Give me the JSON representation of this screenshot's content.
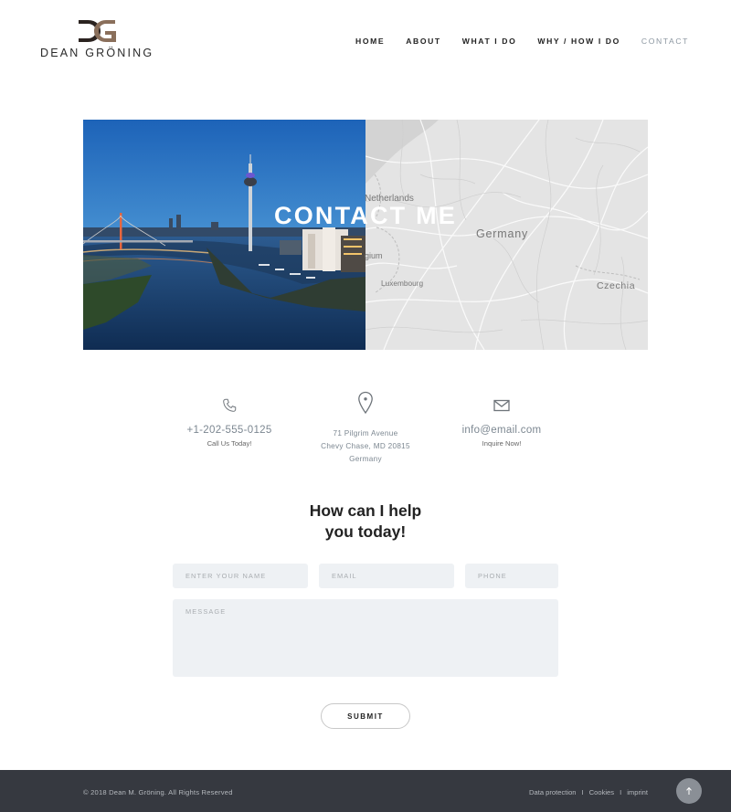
{
  "brand": {
    "name": "DEAN GRÖNING",
    "monogram": "DG"
  },
  "nav": {
    "items": [
      {
        "label": "HOME",
        "active": false
      },
      {
        "label": "ABOUT",
        "active": false
      },
      {
        "label": "WHAT I DO",
        "active": false
      },
      {
        "label": "WHY / HOW I DO",
        "active": false
      },
      {
        "label": "CONTACT",
        "active": true
      }
    ]
  },
  "hero": {
    "title": "CONTACT ME",
    "map_labels": {
      "netherlands": "Netherlands",
      "germany": "Germany",
      "belgium": "gium",
      "luxembourg": "Luxembourg",
      "czechia": "Czechia"
    }
  },
  "contact": {
    "phone": {
      "icon": "phone-icon",
      "value": "+1-202-555-0125",
      "sub": "Call Us Today!"
    },
    "address": {
      "icon": "map-pin-icon",
      "line1": "71 Pilgrim Avenue",
      "line2": "Chevy Chase, MD 20815",
      "line3": "Germany"
    },
    "email": {
      "icon": "envelope-icon",
      "value": "info@email.com",
      "sub": "Inquire Now!"
    }
  },
  "form": {
    "title_line1": "How can I help",
    "title_line2": "you today!",
    "name_placeholder": "ENTER YOUR NAME",
    "email_placeholder": "EMAIL",
    "phone_placeholder": "PHONE",
    "message_placeholder": "MESSAGE",
    "submit_label": "SUBMIT"
  },
  "footer": {
    "copyright": "© 2018 Dean M. Gröning. All Rights Reserved",
    "links": [
      "Data protection",
      "Cookies",
      "imprint"
    ],
    "separator": "I",
    "top_icon": "arrow-up-icon"
  },
  "colors": {
    "accent_muted": "#8b96a0",
    "footer_bg": "#363940",
    "field_bg": "#eef1f4",
    "map_bg": "#e6e6e6"
  }
}
